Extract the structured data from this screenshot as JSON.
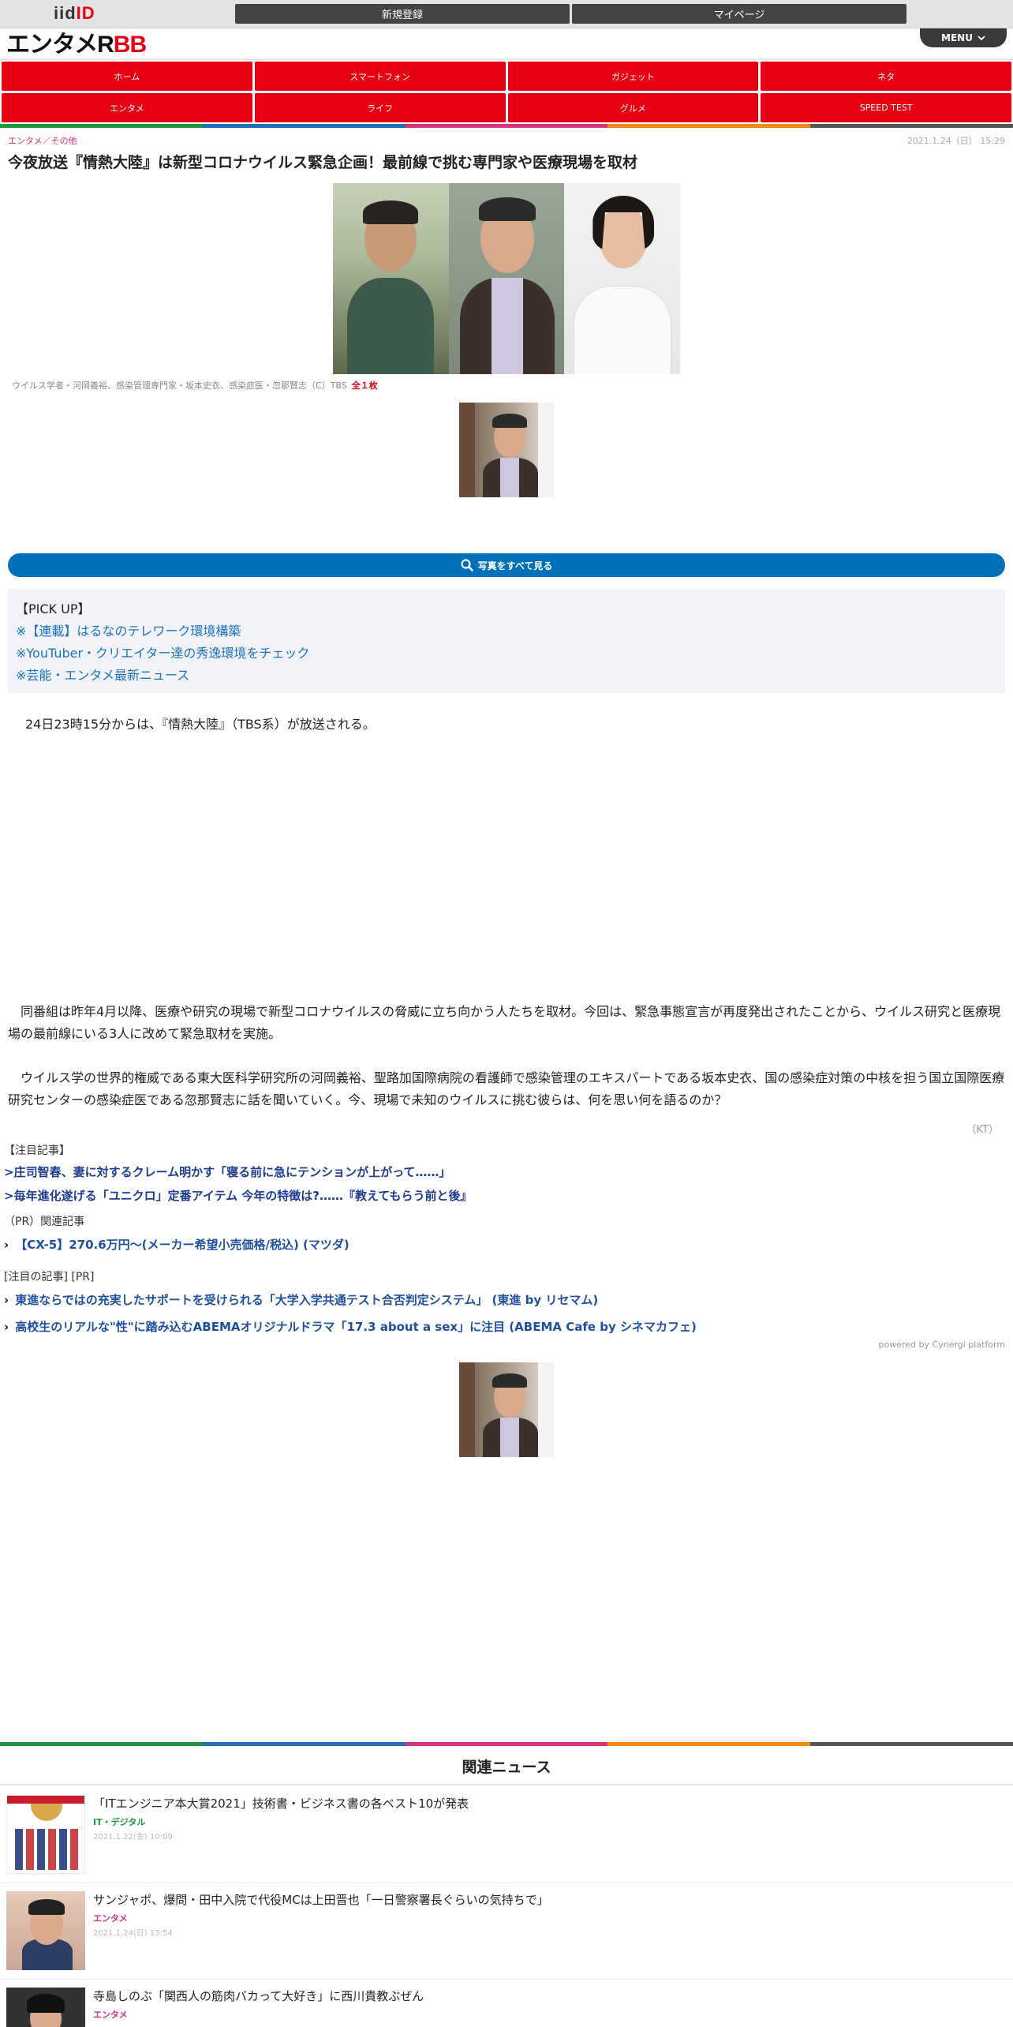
{
  "topbar": {
    "logo_iid": "iid",
    "logo_id": "ID",
    "register_label": "新規登録",
    "mypage_label": "マイページ"
  },
  "header": {
    "logo_main": "エンタメ",
    "logo_r": "R",
    "logo_bb": "BB",
    "menu_label": "MENU"
  },
  "nav": {
    "items": [
      "ホーム",
      "スマートフォン",
      "ガジェット",
      "ネタ",
      "エンタメ",
      "ライフ",
      "グルメ",
      "SPEED TEST"
    ]
  },
  "article": {
    "category": "エンタメ／その他",
    "date": "2021.1.24（日） 15:29",
    "title": "今夜放送『情熱大陸』は新型コロナウイルス緊急企画！最前線で挑む専門家や医療現場を取材",
    "caption": "ウイルス学者・河岡義裕、感染管理専門家・坂本史衣、感染症医・忽那賢志（C）TBS",
    "photo_count": "全１枚",
    "all_photos_label": "写真をすべて見る",
    "para1": "24日23時15分からは、『情熱大陸』（TBS系）が放送される。",
    "para2": "同番組は昨年4月以降、医療や研究の現場で新型コロナウイルスの脅威に立ち向かう人たちを取材。今回は、緊急事態宣言が再度発出されたことから、ウイルス研究と医療現場の最前線にいる3人に改めて緊急取材を実施。",
    "para3": "ウイルス学の世界的権威である東大医科学研究所の河岡義裕、聖路加国際病院の看護師で感染管理のエキスパートである坂本史衣、国の感染症対策の中核を担う国立国際医療研究センターの感染症医である忽那賢志に話を聞いていく。今、現場で未知のウイルスに挑む彼らは、何を思い何を語るのか？",
    "author": "（KT）"
  },
  "pickup": {
    "label": "【PICK UP】",
    "links": [
      "※【連載】はるなのテレワーク環境構築",
      "※YouTuber・クリエイター達の秀逸環境をチェック",
      "※芸能・エンタメ最新ニュース"
    ]
  },
  "featured": {
    "heading": "【注目記事】",
    "links": [
      ">庄司智春、妻に対するクレーム明かす「寝る前に急にテンションが上がって……」",
      ">毎年進化遂げる「ユニクロ」定番アイテム 今年の特徴は?……『教えてもらう前と後』"
    ]
  },
  "pr": {
    "heading": "（PR）関連記事",
    "links": [
      "【CX-5】270.6万円～(メーカー希望小売価格/税込) (マツダ)"
    ]
  },
  "featured_pr": {
    "heading": "[注目の記事] [PR]",
    "links": [
      "東進ならではの充実したサポートを受けられる「大学入学共通テスト合否判定システム」 (東進 by リセマム)",
      "高校生のリアルな\"性\"に踏み込むABEMAオリジナルドラマ「17.3 about a sex」に注目 (ABEMA Cafe by シネマカフェ)"
    ],
    "powered_by": "powered by Cynergi platform"
  },
  "related": {
    "title": "関連ニュース",
    "items": [
      {
        "title": "「ITエンジニア本大賞2021」技術書・ビジネス書の各ベスト10が発表",
        "category": "IT・デジタル",
        "date": "2021.1.22(金) 10:09",
        "color": "#1a9a3c"
      },
      {
        "title": "サンジャポ、爆問・田中入院で代役MCは上田晋也「一日警察署長ぐらいの気持ちで」",
        "category": "エンタメ",
        "date": "2021.1.24(日) 13:54",
        "color": "#d6337f"
      },
      {
        "title": "寺島しのぶ「関西人の筋肉バカって大好き」に西川貴教ぶぜん",
        "category": "エンタメ",
        "date": "",
        "color": "#d6337f"
      }
    ]
  },
  "colors": {
    "brand_red": "#e60012",
    "blue": "#0070b9",
    "stripe": [
      "#1a9a3c",
      "#1f6fbf",
      "#d6337f",
      "#f0891a",
      "#555555"
    ]
  }
}
